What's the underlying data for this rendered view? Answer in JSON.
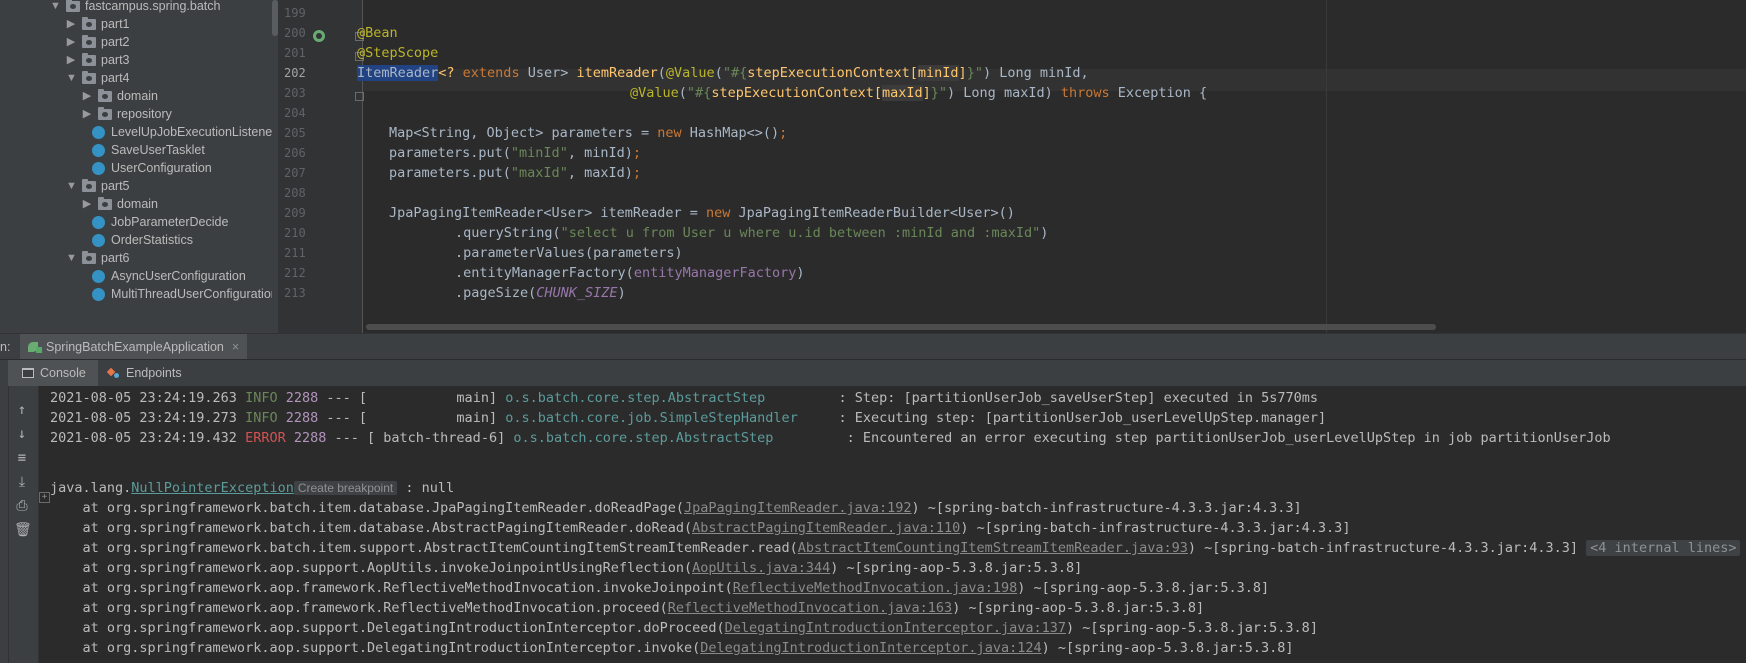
{
  "tree": {
    "root": "fastcampus.spring.batch",
    "items": [
      {
        "label": "part1",
        "kind": "folder",
        "arrow": "▶"
      },
      {
        "label": "part2",
        "kind": "folder",
        "arrow": "▶"
      },
      {
        "label": "part3",
        "kind": "folder",
        "arrow": "▶"
      },
      {
        "label": "part4",
        "kind": "folder",
        "arrow": "▼"
      },
      {
        "label": "domain",
        "kind": "folder",
        "arrow": "▶"
      },
      {
        "label": "repository",
        "kind": "folder",
        "arrow": "▶"
      },
      {
        "label": "LevelUpJobExecutionListener",
        "kind": "class"
      },
      {
        "label": "SaveUserTasklet",
        "kind": "class"
      },
      {
        "label": "UserConfiguration",
        "kind": "class"
      },
      {
        "label": "part5",
        "kind": "folder",
        "arrow": "▼"
      },
      {
        "label": "domain",
        "kind": "folder",
        "arrow": "▶"
      },
      {
        "label": "JobParameterDecide",
        "kind": "class"
      },
      {
        "label": "OrderStatistics",
        "kind": "class"
      },
      {
        "label": "part6",
        "kind": "folder",
        "arrow": "▼"
      },
      {
        "label": "AsyncUserConfiguration",
        "kind": "class"
      },
      {
        "label": "MultiThreadUserConfiguration",
        "kind": "class"
      }
    ]
  },
  "editor": {
    "line_numbers": [
      "199",
      "200",
      "201",
      "202",
      "203",
      "204",
      "205",
      "206",
      "207",
      "208",
      "209",
      "210",
      "211",
      "212",
      "213"
    ],
    "lines": {
      "l200_ann": "@Bean",
      "l201_ann": "@StepScope",
      "l202_type": "ItemReader",
      "l202_a": "<? ",
      "l202_kw": "extends",
      "l202_b": " User> ",
      "l202_fn": "itemReader",
      "l202_c": "(",
      "l202_ann": "@Value",
      "l202_d": "(",
      "l202_str1": "\"#{",
      "l202_e": "stepExecutionContext[",
      "l202_hl": "minId",
      "l202_f": "]",
      "l202_str2": "}\"",
      "l202_g": ") Long minId,",
      "l203_ann": "@Value",
      "l203_a": "(",
      "l203_str1": "\"#{",
      "l203_b": "stepExecutionContext[",
      "l203_hl": "maxId",
      "l203_c": "]",
      "l203_str2": "}\"",
      "l203_d": ") Long maxId) ",
      "l203_kw": "throws",
      "l203_e": " Exception {",
      "l205_a": "Map<String, Object> parameters = ",
      "l205_kw": "new",
      "l205_b": " HashMap<>()",
      "l205_semi": ";",
      "l206_a": "parameters.put(",
      "l206_str": "\"minId\"",
      "l206_b": ", minId)",
      "l206_semi": ";",
      "l207_a": "parameters.put(",
      "l207_str": "\"maxId\"",
      "l207_b": ", maxId)",
      "l207_semi": ";",
      "l209_a": "JpaPagingItemReader<User> itemReader = ",
      "l209_kw": "new",
      "l209_b": " JpaPagingItemReaderBuilder<User>()",
      "l210_a": ".queryString(",
      "l210_str": "\"select u from User u where u.id between :minId and :maxId\"",
      "l210_b": ")",
      "l211_a": ".parameterValues(parameters)",
      "l212_a": ".entityManagerFactory(",
      "l212_fld": "entityManagerFactory",
      "l212_b": ")",
      "l213_a": ".pageSize(",
      "l213_const": "CHUNK_SIZE",
      "l213_b": ")"
    }
  },
  "run": {
    "prefix": "n:",
    "config_tab": "SpringBatchExampleApplication",
    "close_glyph": "×",
    "console_tab": "Console",
    "endpoints_tab": "Endpoints"
  },
  "console": {
    "log": [
      {
        "ts": "2021-08-05 23:24:19.263",
        "level": "INFO",
        "pid": "2288",
        "thread": "--- [           main]",
        "logger": "o.s.batch.core.step.AbstractStep        ",
        "msg": ": Step: [partitionUserJob_saveUserStep] executed in 5s770ms"
      },
      {
        "ts": "2021-08-05 23:24:19.273",
        "level": "INFO",
        "pid": "2288",
        "thread": "--- [           main]",
        "logger": "o.s.batch.core.job.SimpleStepHandler    ",
        "msg": ": Executing step: [partitionUserJob_userLevelUpStep.manager]"
      },
      {
        "ts": "2021-08-05 23:24:19.432",
        "level": "ERROR",
        "pid": "2288",
        "thread": "--- [ batch-thread-6]",
        "logger": "o.s.batch.core.step.AbstractStep        ",
        "msg": ": Encountered an error executing step partitionUserJob_userLevelUpStep in job partitionUserJob"
      }
    ],
    "exception_prefix": "java.lang.",
    "exception_name": "NullPointerException",
    "create_breakpoint": "Create breakpoint",
    "exception_suffix": " : null",
    "stack": [
      {
        "pre": "    at org.springframework.batch.item.database.JpaPagingItemReader.doReadPage(",
        "link": "JpaPagingItemReader.java:192",
        "post": ") ~[spring-batch-infrastructure-4.3.3.jar:4.3.3]"
      },
      {
        "pre": "    at org.springframework.batch.item.database.AbstractPagingItemReader.doRead(",
        "link": "AbstractPagingItemReader.java:110",
        "post": ") ~[spring-batch-infrastructure-4.3.3.jar:4.3.3]"
      },
      {
        "pre": "    at org.springframework.batch.item.support.AbstractItemCountingItemStreamItemReader.read(",
        "link": "AbstractItemCountingItemStreamItemReader.java:93",
        "post": ") ~[spring-batch-infrastructure-4.3.3.jar:4.3.3]",
        "extra": "<4 internal lines>"
      },
      {
        "pre": "    at org.springframework.aop.support.AopUtils.invokeJoinpointUsingReflection(",
        "link": "AopUtils.java:344",
        "post": ") ~[spring-aop-5.3.8.jar:5.3.8]"
      },
      {
        "pre": "    at org.springframework.aop.framework.ReflectiveMethodInvocation.invokeJoinpoint(",
        "link": "ReflectiveMethodInvocation.java:198",
        "post": ") ~[spring-aop-5.3.8.jar:5.3.8]"
      },
      {
        "pre": "    at org.springframework.aop.framework.ReflectiveMethodInvocation.proceed(",
        "link": "ReflectiveMethodInvocation.java:163",
        "post": ") ~[spring-aop-5.3.8.jar:5.3.8]"
      },
      {
        "pre": "    at org.springframework.aop.support.DelegatingIntroductionInterceptor.doProceed(",
        "link": "DelegatingIntroductionInterceptor.java:137",
        "post": ") ~[spring-aop-5.3.8.jar:5.3.8]"
      },
      {
        "pre": "    at org.springframework.aop.support.DelegatingIntroductionInterceptor.invoke(",
        "link": "DelegatingIntroductionInterceptor.java:124",
        "post": ") ~[spring-aop-5.3.8.jar:5.3.8]"
      }
    ]
  },
  "toolbar": {
    "icons": [
      {
        "name": "scroll-up-icon",
        "glyph": "↑"
      },
      {
        "name": "scroll-down-icon",
        "glyph": "↓"
      },
      {
        "name": "soft-wrap-icon",
        "glyph": "≡"
      },
      {
        "name": "scroll-to-end-icon",
        "glyph": "⤓"
      },
      {
        "name": "print-icon",
        "glyph": "⎙"
      },
      {
        "name": "clear-all-icon",
        "glyph": "🗑"
      }
    ]
  }
}
